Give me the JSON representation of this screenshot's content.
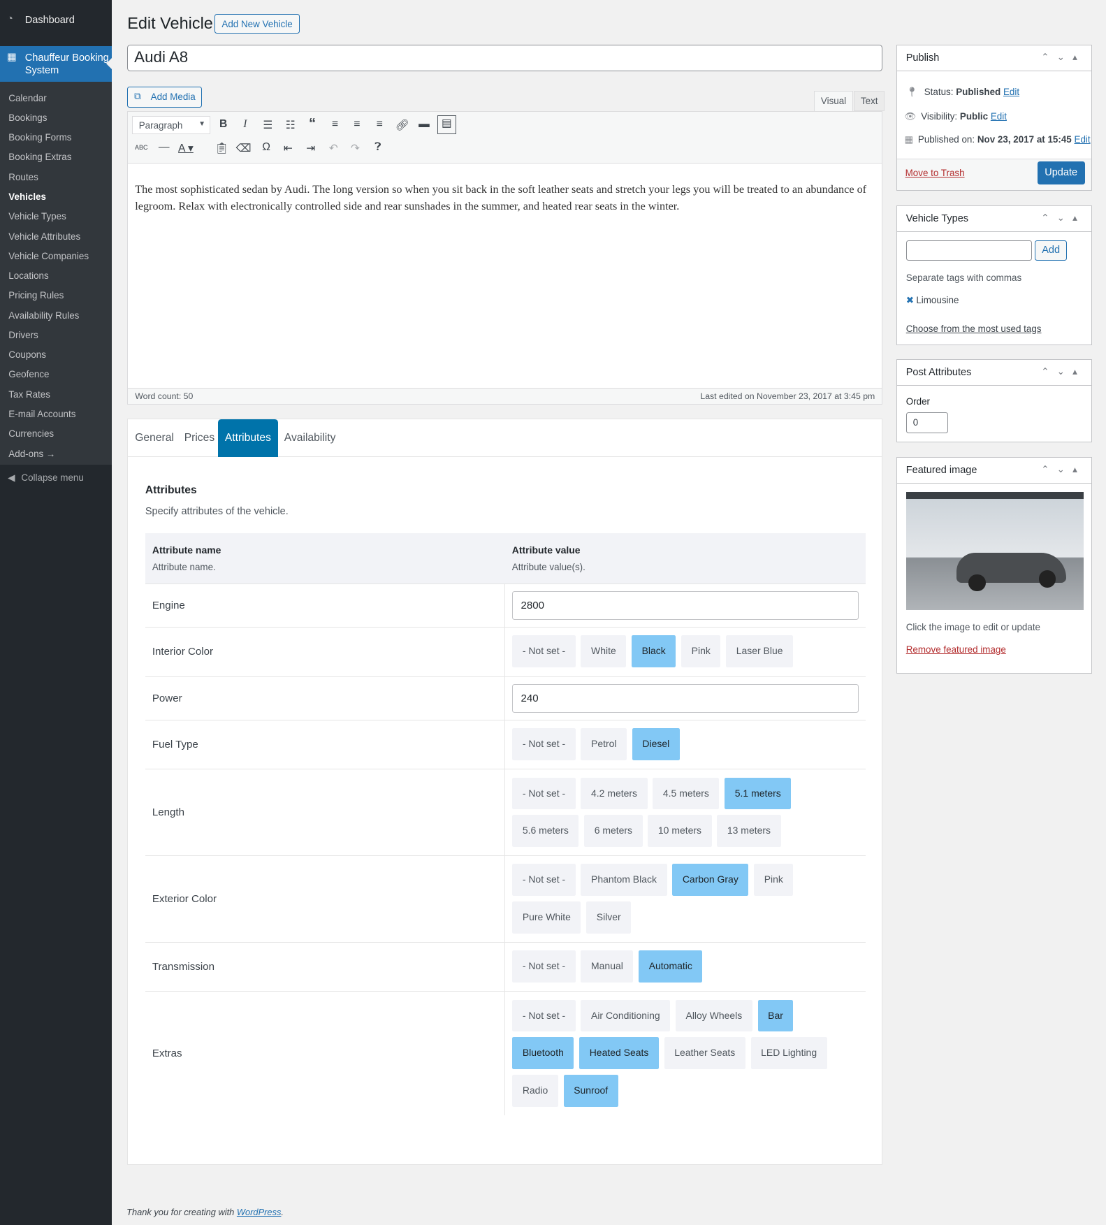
{
  "sidebar": {
    "dashboard": "Dashboard",
    "active": "Chauffeur Booking System",
    "items": [
      "Calendar",
      "Bookings",
      "Booking Forms",
      "Booking Extras",
      "Routes",
      "Vehicles",
      "Vehicle Types",
      "Vehicle Attributes",
      "Vehicle Companies",
      "Locations",
      "Pricing Rules",
      "Availability Rules",
      "Drivers",
      "Coupons",
      "Geofence",
      "Tax Rates",
      "E-mail Accounts",
      "Currencies",
      "Add-ons →"
    ],
    "current": "Vehicles",
    "collapse": "Collapse menu"
  },
  "header": {
    "title": "Edit Vehicle",
    "add_new": "Add New Vehicle"
  },
  "post_title": "Audi A8",
  "editor": {
    "add_media": "Add Media",
    "tab_visual": "Visual",
    "tab_text": "Text",
    "format": "Paragraph",
    "content": "The most sophisticated sedan by Audi. The long version so when you sit back in the soft leather seats and stretch your legs you will be treated to an abundance of legroom. Relax with electronically controlled side and rear sunshades in the summer, and heated rear seats in the winter.",
    "word_count": "Word count: 50",
    "last_edited": "Last edited on November 23, 2017 at 3:45 pm"
  },
  "tabs": [
    "General",
    "Prices",
    "Attributes",
    "Availability"
  ],
  "attributes": {
    "heading": "Attributes",
    "desc": "Specify attributes of the vehicle.",
    "col_name": "Attribute name",
    "col_name_sub": "Attribute name.",
    "col_value": "Attribute value",
    "col_value_sub": "Attribute value(s).",
    "rows": [
      {
        "name": "Engine",
        "input": "2800"
      },
      {
        "name": "Interior Color",
        "options": [
          "- Not set -",
          "White",
          "Black",
          "Pink",
          "Laser Blue"
        ],
        "selected": [
          "Black"
        ]
      },
      {
        "name": "Power",
        "input": "240"
      },
      {
        "name": "Fuel Type",
        "options": [
          "- Not set -",
          "Petrol",
          "Diesel"
        ],
        "selected": [
          "Diesel"
        ]
      },
      {
        "name": "Length",
        "options": [
          "- Not set -",
          "4.2 meters",
          "4.5 meters",
          "5.1 meters",
          "5.6 meters",
          "6 meters",
          "10 meters",
          "13 meters"
        ],
        "selected": [
          "5.1 meters"
        ]
      },
      {
        "name": "Exterior Color",
        "options": [
          "- Not set -",
          "Phantom Black",
          "Carbon Gray",
          "Pink",
          "Pure White",
          "Silver"
        ],
        "selected": [
          "Carbon Gray"
        ]
      },
      {
        "name": "Transmission",
        "options": [
          "- Not set -",
          "Manual",
          "Automatic"
        ],
        "selected": [
          "Automatic"
        ]
      },
      {
        "name": "Extras",
        "options": [
          "- Not set -",
          "Air Conditioning",
          "Alloy Wheels",
          "Bar",
          "Bluetooth",
          "Heated Seats",
          "Leather Seats",
          "LED Lighting",
          "Radio",
          "Sunroof"
        ],
        "selected": [
          "Bar",
          "Bluetooth",
          "Heated Seats",
          "Sunroof"
        ]
      }
    ]
  },
  "publish": {
    "title": "Publish",
    "status_label": "Status:",
    "status": "Published",
    "visibility_label": "Visibility:",
    "visibility": "Public",
    "published_label": "Published on:",
    "published": "Nov 23, 2017 at 15:45",
    "edit": "Edit",
    "trash": "Move to Trash",
    "update": "Update"
  },
  "vehicle_types": {
    "title": "Vehicle Types",
    "add": "Add",
    "hint": "Separate tags with commas",
    "tag": "Limousine",
    "most_used": "Choose from the most used tags"
  },
  "post_attributes": {
    "title": "Post Attributes",
    "order_label": "Order",
    "order": "0"
  },
  "featured": {
    "title": "Featured image",
    "hint": "Click the image to edit or update",
    "remove": "Remove featured image"
  },
  "footer": {
    "text": "Thank you for creating with ",
    "link": "WordPress",
    "end": "."
  },
  "colors": {
    "accent": "#2271b1",
    "tab_active": "#0073aa",
    "selected_option": "#82c8f5"
  }
}
